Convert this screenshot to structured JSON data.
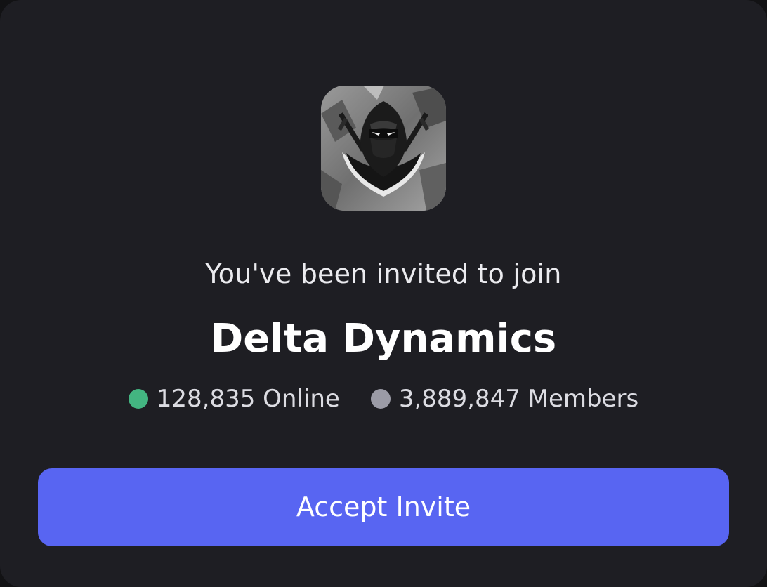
{
  "invite": {
    "subtitle": "You've been invited to join",
    "server_name": "Delta Dynamics",
    "server_icon": "hooded-ninja-logo-icon",
    "online": {
      "text": "128,835 Online",
      "color": "#43b581"
    },
    "members": {
      "text": "3,889,847 Members",
      "color": "#9b9ba6"
    },
    "accept_label": "Accept Invite",
    "accent_color": "#5865f2"
  }
}
